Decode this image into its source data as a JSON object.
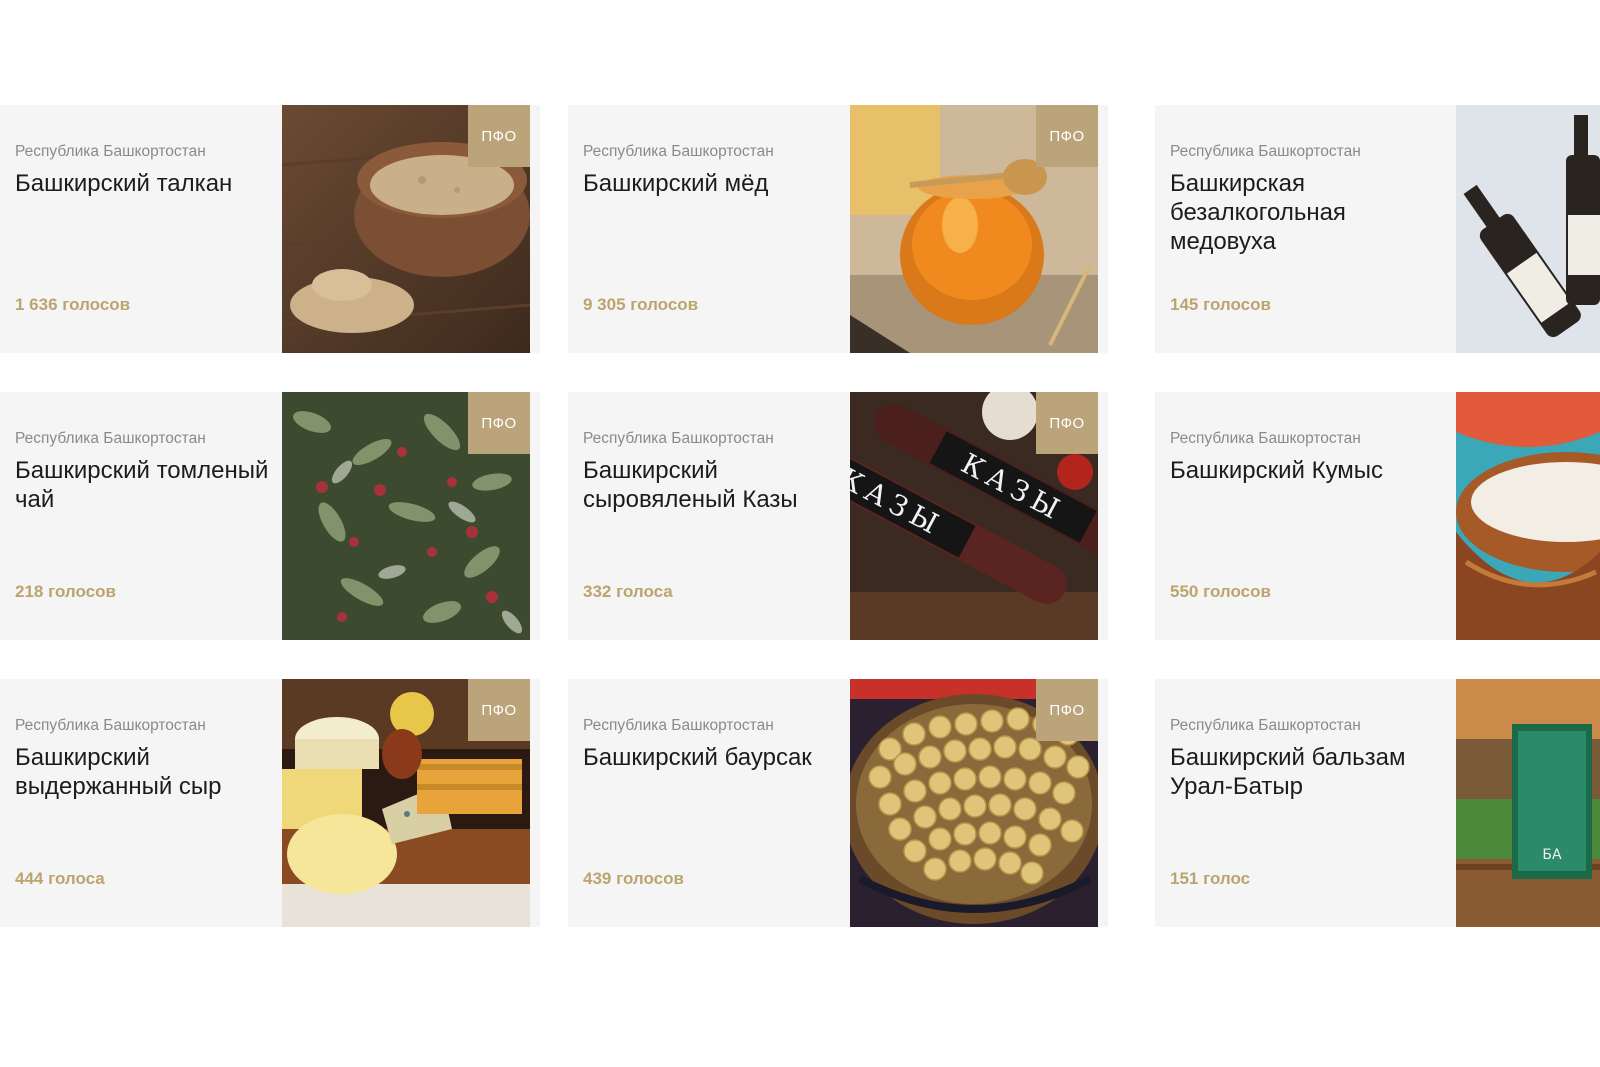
{
  "colors": {
    "votes": "#bca46f",
    "badge": "#bca47a",
    "card_bg": "#f5f5f5",
    "title": "#1c1c1c",
    "region": "#8a8a8a"
  },
  "cards": [
    {
      "region": "Республика Башкортостан",
      "title": "Башкирский талкан",
      "votes": "1 636 голосов",
      "badge": "ПФО",
      "photo_icon": "talkan-bowl"
    },
    {
      "region": "Республика Башкортостан",
      "title": "Башкирский мёд",
      "votes": "9 305 голосов",
      "badge": "ПФО",
      "photo_icon": "honey-jar"
    },
    {
      "region": "Республика Башкортостан",
      "title": "Башкирская безалкогольная медовуха",
      "votes": "145 голосов",
      "badge": "",
      "photo_icon": "medovukha-bottles"
    },
    {
      "region": "Республика Башкортостан",
      "title": "Башкирский томленый чай",
      "votes": "218 голосов",
      "badge": "ПФО",
      "photo_icon": "herbal-tea"
    },
    {
      "region": "Республика Башкортостан",
      "title": "Башкирский сыровяленый Казы",
      "votes": "332 голоса",
      "badge": "ПФО",
      "photo_icon": "kazy-sausage",
      "photo_text": "КАЗЫ"
    },
    {
      "region": "Республика Башкортостан",
      "title": "Башкирский Кумыс",
      "votes": "550 голосов",
      "badge": "",
      "photo_icon": "kumys-bowl"
    },
    {
      "region": "Республика Башкортостан",
      "title": "Башкирский выдержанный сыр",
      "votes": "444 голоса",
      "badge": "ПФО",
      "photo_icon": "cheese-board"
    },
    {
      "region": "Республика Башкортостан",
      "title": "Башкирский баурсак",
      "votes": "439 голосов",
      "badge": "ПФО",
      "photo_icon": "baursak-plate"
    },
    {
      "region": "Республика Башкортостан",
      "title": "Башкирский бальзам Урал-Батыр",
      "votes": "151 голос",
      "badge": "",
      "photo_icon": "balsam-box",
      "photo_text": "БА"
    }
  ]
}
